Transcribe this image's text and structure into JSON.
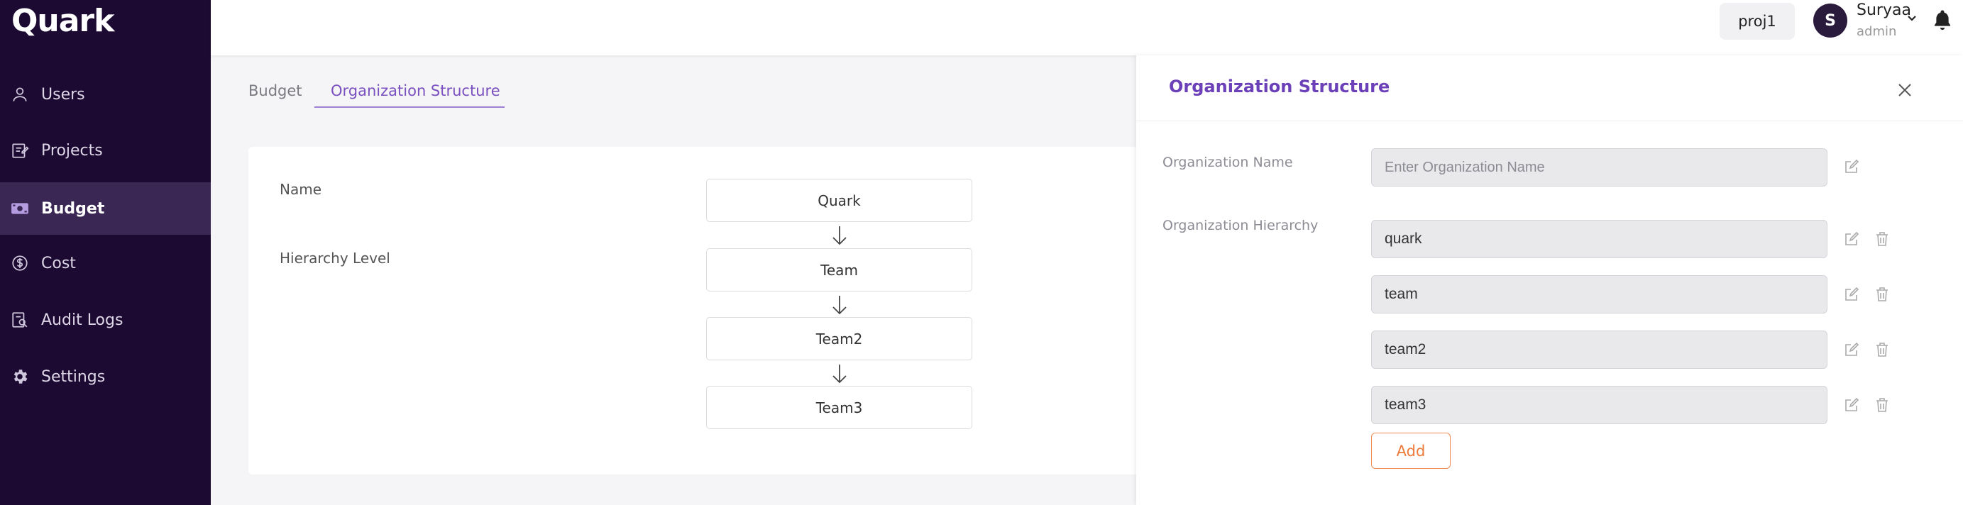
{
  "app": {
    "logo": "Quark"
  },
  "sidebar": {
    "items": [
      {
        "label": "Users",
        "icon": "user-icon"
      },
      {
        "label": "Projects",
        "icon": "edit-document-icon"
      },
      {
        "label": "Budget",
        "icon": "money-icon",
        "active": true
      },
      {
        "label": "Cost",
        "icon": "dollar-circle-icon"
      },
      {
        "label": "Audit Logs",
        "icon": "audit-search-icon"
      },
      {
        "label": "Settings",
        "icon": "gear-icon"
      }
    ]
  },
  "header": {
    "project": "proj1",
    "avatar_initial": "S",
    "user_name": "Suryaa",
    "user_role": "admin"
  },
  "tabs": [
    {
      "label": "Budget"
    },
    {
      "label": "Organization Structure",
      "active": true
    }
  ],
  "structure": {
    "name_label": "Name",
    "hierarchy_label": "Hierarchy Level",
    "levels": [
      "Quark",
      "Team",
      "Team2",
      "Team3"
    ]
  },
  "panel": {
    "title": "Organization Structure",
    "org_name_label": "Organization Name",
    "org_name_placeholder": "Enter Organization Name",
    "hierarchy_label": "Organization Hierarchy",
    "hierarchy": [
      "quark",
      "team",
      "team2",
      "team3"
    ],
    "add_label": "Add"
  },
  "colors": {
    "sidebar_bg": "#1d0a33",
    "accent": "#6b40b8",
    "add_button": "#ee7a3a"
  }
}
